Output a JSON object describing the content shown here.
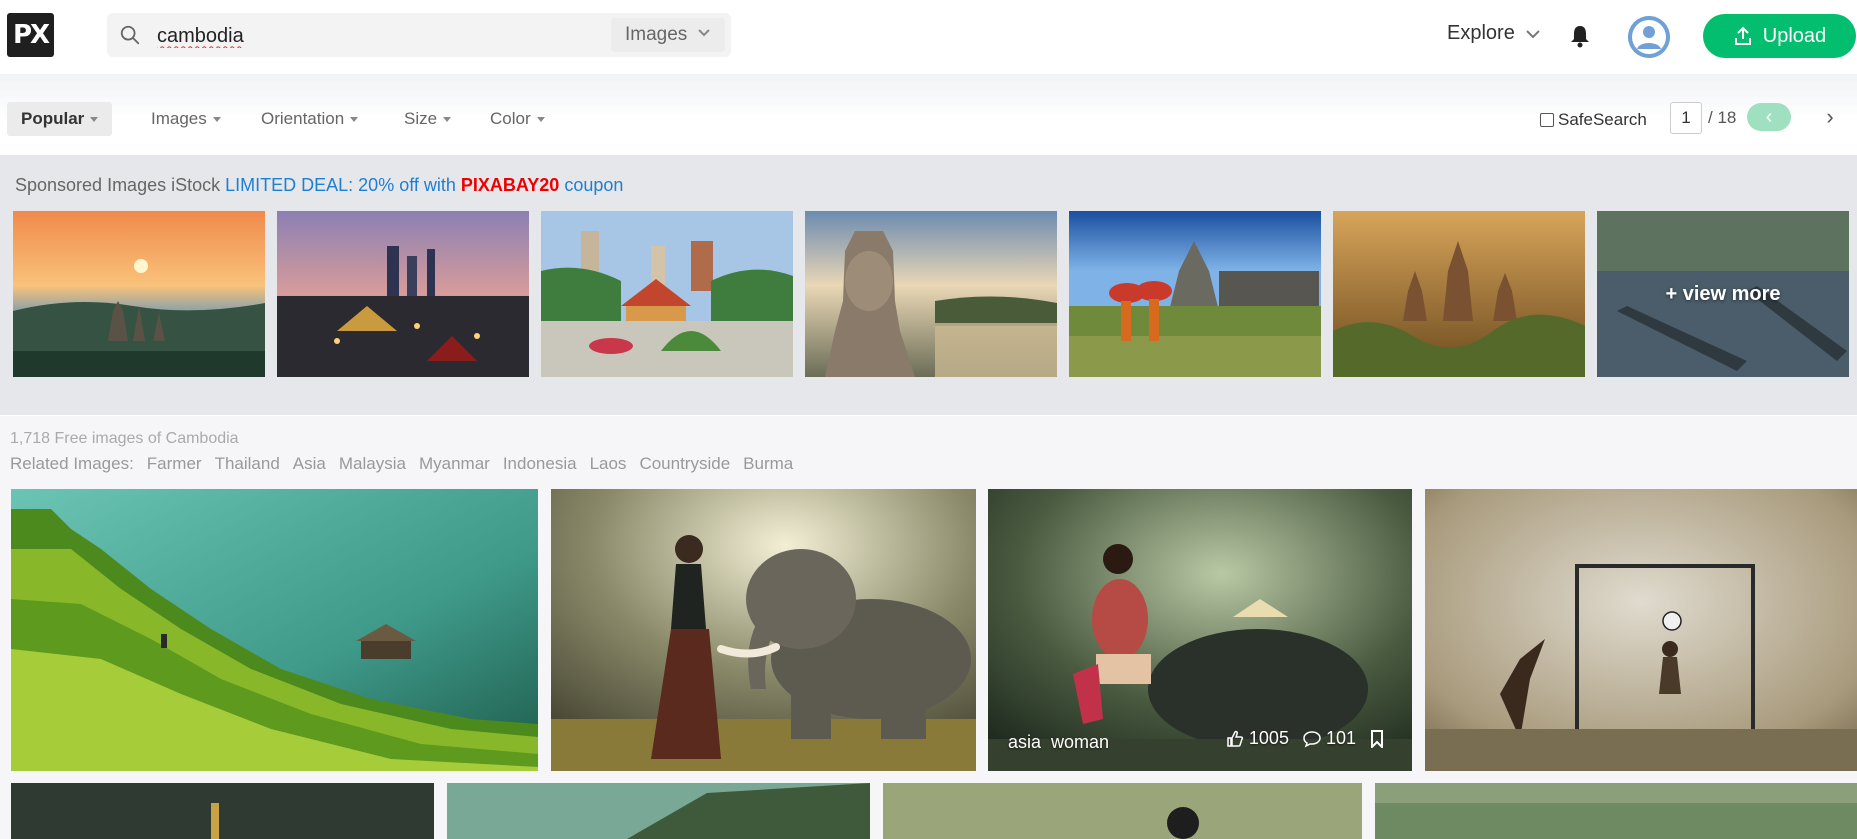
{
  "header": {
    "logo_text": "PX",
    "search": {
      "value": "cambodia",
      "placeholder": "",
      "type_label": "Images"
    },
    "explore_label": "Explore",
    "upload_label": "Upload"
  },
  "filters": {
    "items": [
      "Popular",
      "Images",
      "Orientation",
      "Size",
      "Color"
    ],
    "safesearch_label": "SafeSearch",
    "page_current": "1",
    "page_total": "/ 18"
  },
  "sponsored": {
    "prefix": "Sponsored Images iStock",
    "deal_text": "LIMITED DEAL: 20% off with",
    "code": "PIXABAY20",
    "suffix": "coupon",
    "view_more": "+ view more"
  },
  "results": {
    "count_text": "1,718 Free images of Cambodia",
    "related_label": "Related Images:",
    "related": [
      "Farmer",
      "Thailand",
      "Asia",
      "Malaysia",
      "Myanmar",
      "Indonesia",
      "Laos",
      "Countryside",
      "Burma"
    ],
    "hover_tags": [
      "asia",
      "woman"
    ],
    "likes": "1005",
    "comments": "101"
  },
  "colors": {
    "accent": "#02be6e",
    "deal": "#1d7fd4",
    "coupon": "#ee0000"
  }
}
